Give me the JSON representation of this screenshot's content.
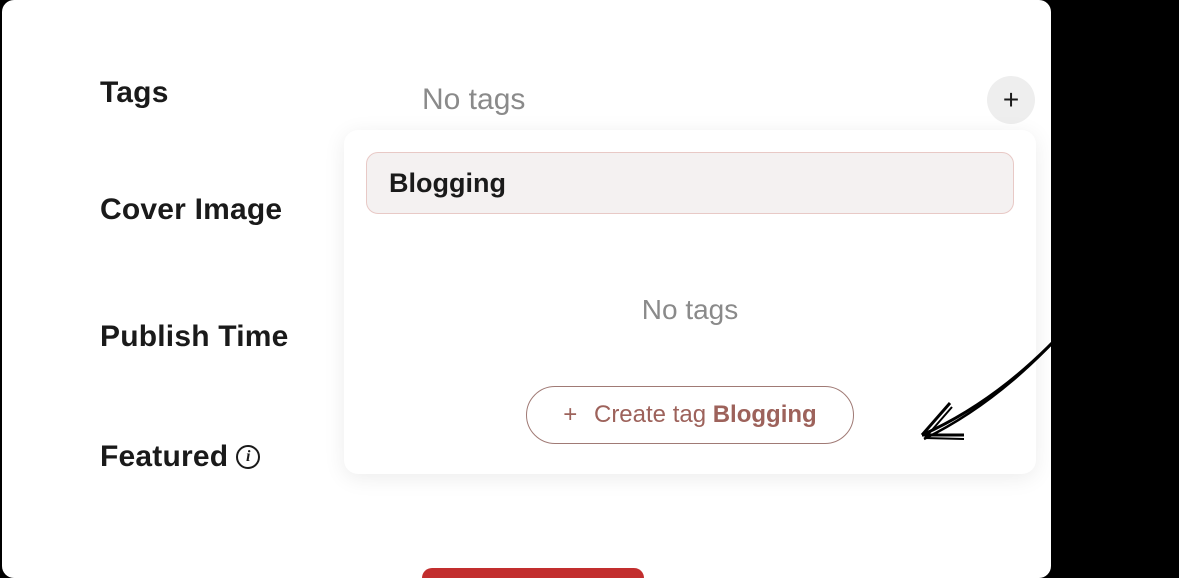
{
  "labels": {
    "tags": "Tags",
    "cover_image": "Cover Image",
    "publish_time": "Publish Time",
    "featured": "Featured"
  },
  "tags_row": {
    "placeholder": "No tags"
  },
  "dropdown": {
    "input_value": "Blogging",
    "empty_text": "No tags",
    "create_prefix": "Create tag ",
    "create_value": "Blogging"
  },
  "icons": {
    "plus": "+",
    "info": "i"
  }
}
